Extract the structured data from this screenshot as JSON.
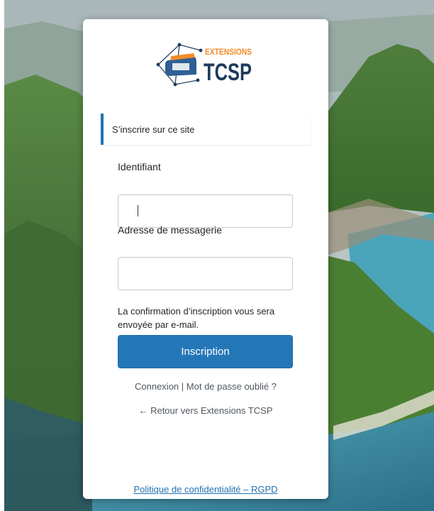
{
  "logo": {
    "top_text": "EXTENSIONS",
    "main_text": "TCSP",
    "colors": {
      "orange": "#f28c28",
      "navy": "#1f3a5c",
      "blue": "#2f5f95"
    }
  },
  "notice": {
    "text": "S’inscrire sur ce site",
    "accent": "#2271b1"
  },
  "form": {
    "username": {
      "label": "Identifiant",
      "value": "",
      "placeholder": ""
    },
    "email": {
      "label": "Adresse de messagerie",
      "value": "",
      "placeholder": ""
    },
    "hint": "La confirmation d’inscription vous sera envoyée par e-mail.",
    "submit_label": "Inscription",
    "button_color": "#2477b6"
  },
  "nav": {
    "login_label": "Connexion",
    "separator": "|",
    "lost_password_label": "Mot de passe oublié ?",
    "back_arrow": "←",
    "back_label": "Retour vers Extensions TCSP"
  },
  "footer": {
    "privacy_label": "Politique de confidentialité – RGPD"
  }
}
